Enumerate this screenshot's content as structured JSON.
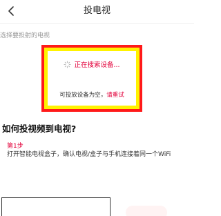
{
  "header": {
    "title": "投电视",
    "back_icon": "chevron-left-icon"
  },
  "device_section": {
    "label": "选择要投射的电视",
    "searching_text": "正在搜索设备...",
    "spinner_icon": "loading-spinner-icon",
    "empty_text": "可投放设备为空，",
    "retry_label": "请重试"
  },
  "howto": {
    "title": "如何投视频到电视?",
    "step1_label": "第1步",
    "step1_text": "打开智能电视盒子，确认电视/盒子与手机连接着同一个WiFi"
  },
  "colors": {
    "accent": "#e2003a",
    "highlight_border": "#ff1a1a",
    "highlight_fill": "#fff200"
  }
}
